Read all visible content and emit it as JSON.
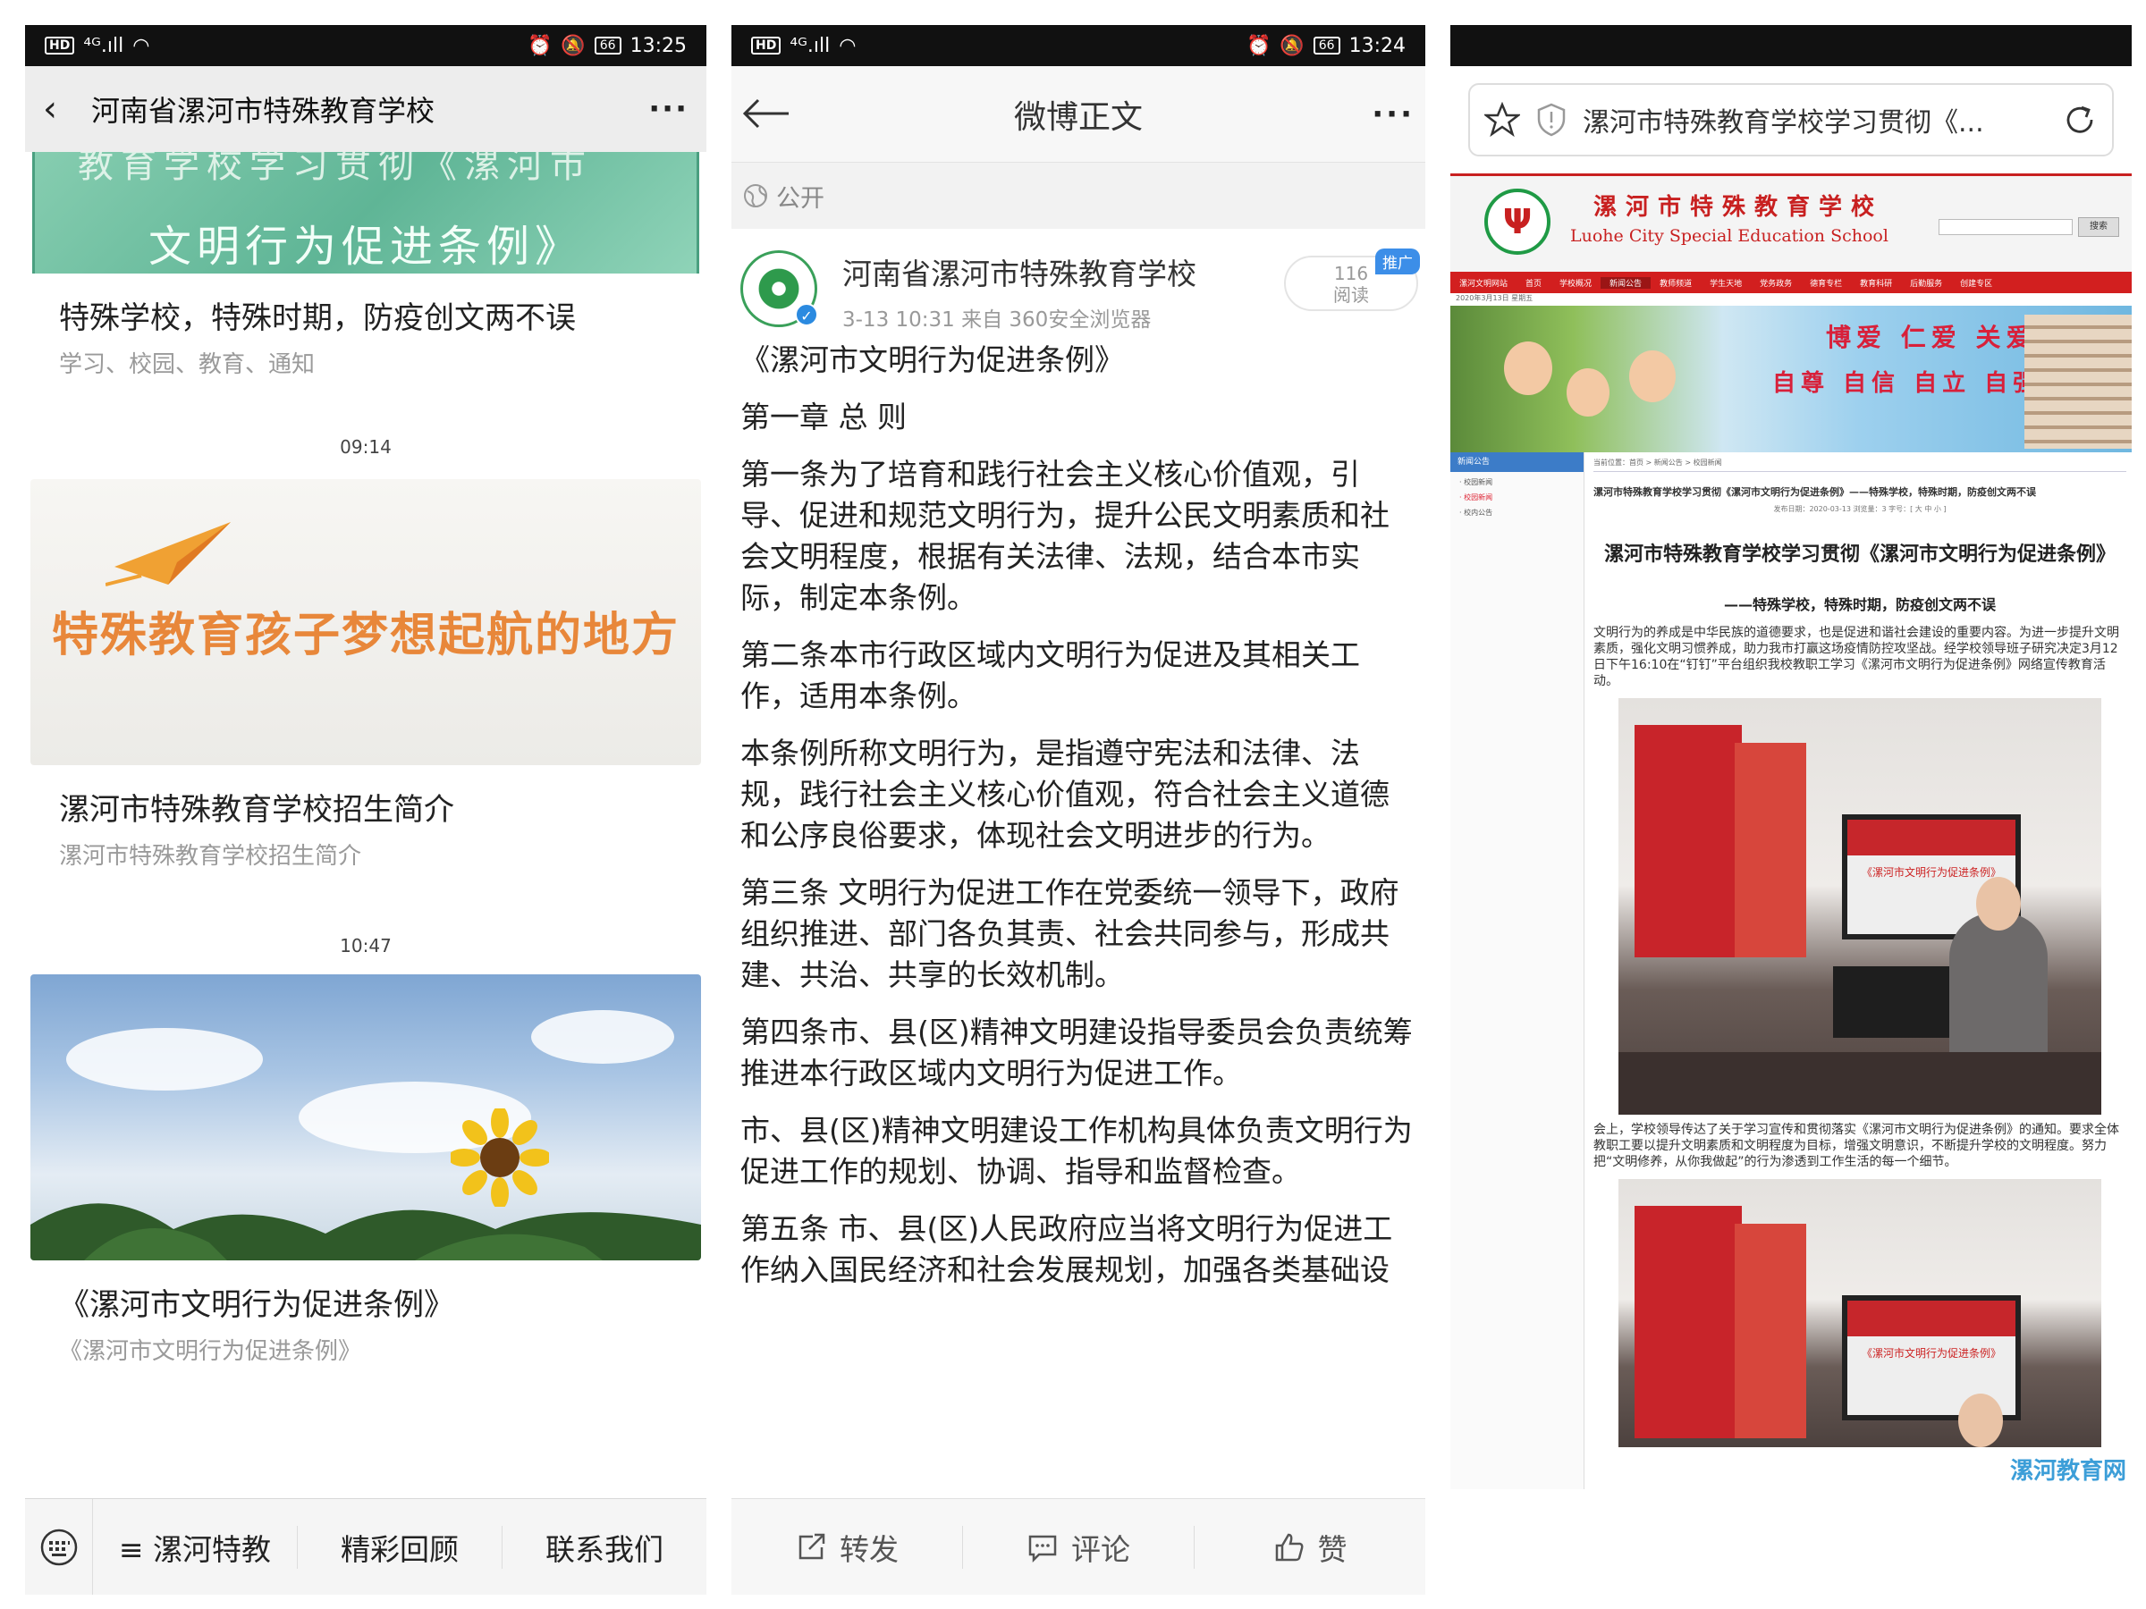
{
  "panel1": {
    "status": {
      "time": "13:25",
      "network": "4G"
    },
    "header": {
      "title": "河南省漯河市特殊教育学校"
    },
    "top_banner": {
      "cut_text": "教育学校学习贯彻《漯河市",
      "main_text": "文明行为促进条例》"
    },
    "articles": [
      {
        "title": "特殊学校，特殊时期，防疫创文两不误",
        "subtitle": "学习、校园、教育、通知"
      },
      {
        "banner_text": "特殊教育孩子梦想起航的地方",
        "title": "漯河市特殊教育学校招生简介",
        "subtitle": "漯河市特殊教育学校招生简介"
      },
      {
        "title": "《漯河市文明行为促进条例》",
        "subtitle": "《漯河市文明行为促进条例》"
      }
    ],
    "times": [
      "09:14",
      "10:47"
    ],
    "bottom_menu": [
      "≡ 漯河特教",
      "精彩回顾",
      "联系我们"
    ]
  },
  "panel2": {
    "status": {
      "time": "13:24",
      "network": "4G"
    },
    "header": {
      "title": "微博正文"
    },
    "visibility": "公开",
    "post": {
      "author": "河南省漯河市特殊教育学校",
      "meta": "3-13 10:31  来自 360安全浏览器",
      "promo": "推广",
      "read_count": "116",
      "read_label": "阅读",
      "paragraphs": [
        "《漯河市文明行为促进条例》",
        "第一章 总 则",
        "第一条为了培育和践行社会主义核心价值观，引导、促进和规范文明行为，提升公民文明素质和社会文明程度，根据有关法律、法规，结合本市实际，制定本条例。",
        "第二条本市行政区域内文明行为促进及其相关工作，适用本条例。",
        "本条例所称文明行为，是指遵守宪法和法律、法规，践行社会主义核心价值观，符合社会主义道德和公序良俗要求，体现社会文明进步的行为。",
        "第三条 文明行为促进工作在党委统一领导下，政府组织推进、部门各负其责、社会共同参与，形成共建、共治、共享的长效机制。",
        "第四条市、县(区)精神文明建设指导委员会负责统筹推进本行政区域内文明行为促进工作。",
        "市、县(区)精神文明建设工作机构具体负责文明行为促进工作的规划、协调、指导和监督检查。",
        "第五条 市、县(区)人民政府应当将文明行为促进工作纳入国民经济和社会发展规划，加强各类基础设"
      ]
    },
    "actions": [
      "转发",
      "评论",
      "赞"
    ]
  },
  "panel3": {
    "url_title": "漯河市特殊教育学校学习贯彻《...",
    "site": {
      "name_cn": "漯河市特殊教育学校",
      "name_en": "Luohe City Special Education School",
      "search_btn": "搜索",
      "nav": [
        "漯河文明网站",
        "首页",
        "学校概况",
        "新闻公告",
        "教师频道",
        "学生天地",
        "党务政务",
        "德育专栏",
        "教育科研",
        "后勤服务",
        "创建专区"
      ],
      "date": "2020年3月13日 星期五",
      "motto_line1": "博爱  仁爱  关爱  慈爱",
      "motto_line2": "自尊  自信  自立  自强",
      "left_header": "新闻公告",
      "left_items": [
        "· 校园新闻",
        "· 校园新闻",
        "· 校内公告"
      ],
      "breadcrumb": "当前位置：首页 > 新闻公告 > 校园新闻",
      "article_head": "漯河市特殊教育学校学习贯彻《漯河市文明行为促进条例》——特殊学校，特殊时期，防疫创文两不误",
      "article_meta": "发布日期：2020-03-13  浏览量：3  字号：[ 大 中 小 ]",
      "article_title": "漯河市特殊教育学校学习贯彻《漯河市文明行为促进条例》",
      "article_subtitle": "——特殊学校，特殊时期，防疫创文两不误",
      "para1": "文明行为的养成是中华民族的道德要求，也是促进和谐社会建设的重要内容。为进一步提升文明素质，强化文明习惯养成，助力我市打赢这场疫情防控攻坚战。经学校领导班子研究决定3月12日下午16:10在“钉钉”平台组织我校教职工学习《漯河市文明行为促进条例》网络宣传教育活动。",
      "photo_tv_text": "《漯河市文明行为促进条例》",
      "para2": "会上，学校领导传达了关于学习宣传和贯彻落实《漯河市文明行为促进条例》的通知。要求全体教职工要以提升文明素质和文明程度为目标，增强文明意识，不断提升学校的文明程度。努力把“文明修养，从你我做起”的行为渗透到工作生活的每一个细节。",
      "watermark": "漯河教育网"
    }
  }
}
